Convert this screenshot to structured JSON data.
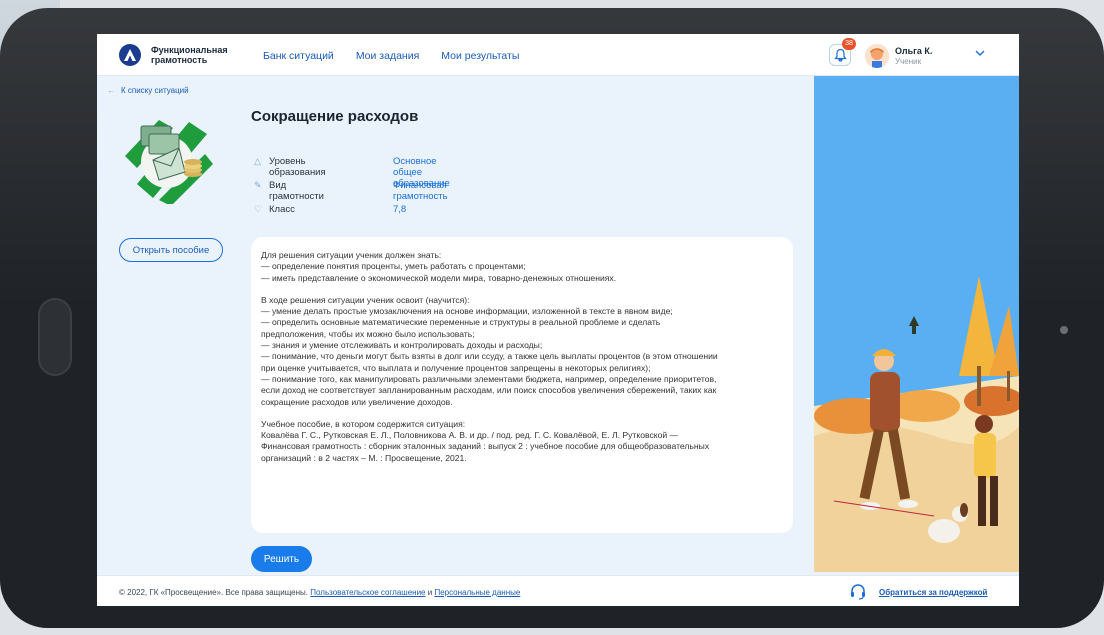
{
  "header": {
    "logo_text": "Функциональная грамотность",
    "nav": [
      "Банк ситуаций",
      "Мои задания",
      "Мои результаты"
    ],
    "notification_count": "38",
    "user_name": "Ольга К.",
    "user_role": "Ученик"
  },
  "back_link": "К списку ситуаций",
  "open_guide_label": "Открыть пособие",
  "title": "Сокращение расходов",
  "properties": [
    {
      "label": "Уровень образования",
      "value": "Основное общее образование",
      "icon": "level-icon"
    },
    {
      "label": "Вид грамотности",
      "value": "Финансовая грамотность",
      "icon": "pencil-icon"
    },
    {
      "label": "Класс",
      "value": "7,8",
      "icon": "grade-icon"
    }
  ],
  "description": {
    "block1": [
      "Для решения ситуации ученик должен знать:",
      "— определение понятия проценты, уметь работать с процентами;",
      "— иметь представление о экономической модели мира, товарно-денежных отношениях."
    ],
    "block2": [
      "В ходе решения ситуации ученик освоит (научится):",
      "— умение делать простые умозаключения на основе информации, изложенной в тексте в явном виде;",
      "— определить основные математические переменные и структуры в реальной проблеме и сделать",
      "предположения, чтобы их можно было использовать;",
      "— знания и умение отслеживать и контролировать доходы и расходы;",
      "— понимание, что деньги могут быть взяты в долг или ссуду, а также цель выплаты процентов (в этом отношении",
      "при оценке учитывается, что выплата и получение процентов запрещены в некоторых религиях);",
      "— понимание того, как манипулировать различными элементами бюджета, например, определение приоритетов,",
      "если доход не соответствует запланированным расходам, или поиск способов увеличения сбережений, таких как",
      "сокращение расходов или увеличение доходов."
    ],
    "block3": [
      "Учебное пособие, в котором содержится ситуация:",
      "Ковалёва Г. С., Рутковская Е. Л., Половникова А. В. и др. / под. ред. Г. С. Ковалёвой, Е. Л. Рутковской —",
      "Финансовая грамотность : сборник эталонных заданий : выпуск 2 : учебное пособие для общеобразовательных",
      "организаций : в 2 частях – М. : Просвещение, 2021."
    ]
  },
  "solve_label": "Решить",
  "footer": {
    "copyright": "© 2022, ГК «Просвещение». Все права защищены.",
    "agreement": "Пользовательское соглашение",
    "and": "и",
    "personal_data": "Персональные данные",
    "support": "Обратиться за поддержкой"
  }
}
